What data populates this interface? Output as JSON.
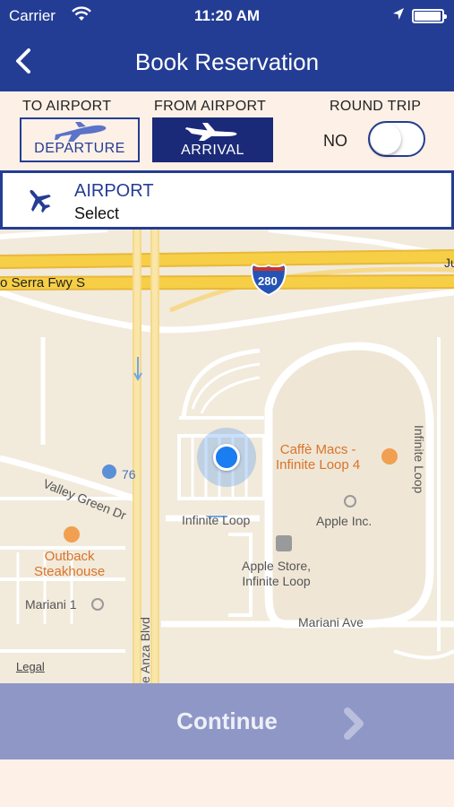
{
  "status_bar": {
    "carrier": "Carrier",
    "time": "11:20 AM"
  },
  "nav": {
    "title": "Book Reservation"
  },
  "trip_options": {
    "to_airport_label": "TO AIRPORT",
    "from_airport_label": "FROM AIRPORT",
    "round_trip_label": "ROUND TRIP",
    "departure_button": "DEPARTURE",
    "arrival_button": "ARRIVAL",
    "round_trip_value": "NO",
    "round_trip_on": false
  },
  "airport": {
    "label": "AIRPORT",
    "value": "Select"
  },
  "map": {
    "labels": {
      "junipero": "Ju",
      "serra_fwy": "o Serra Fwy S",
      "shield_280": "280",
      "valley_green": "Valley Green Dr",
      "gas_76": "76",
      "outback": "Outback\nSteakhouse",
      "mariani_1": "Mariani 1",
      "anza_blvd": "e Anza Blvd",
      "infinite_loop_road": "Infinite Loop",
      "infinite_loop_vertical": "Infinite Loop",
      "caffe_macs": "Caffè Macs -\nInfinite Loop 4",
      "apple_inc": "Apple Inc.",
      "apple_store": "Apple Store,\nInfinite Loop",
      "mariani_ave": "Mariani Ave",
      "legal": "Legal"
    }
  },
  "continue_button": {
    "label": "Continue"
  },
  "colors": {
    "brand_blue": "#243d94",
    "arrival_bg": "#1b2a78",
    "background": "#fdf0e6",
    "continue_bg": "#8f97c7",
    "highway_yellow": "#f6cf46",
    "user_location": "#1a7df0"
  },
  "icons": [
    "back-chevron-icon",
    "plane-icon",
    "wifi-icon",
    "location-arrow-icon",
    "battery-icon",
    "chevron-right-icon"
  ]
}
